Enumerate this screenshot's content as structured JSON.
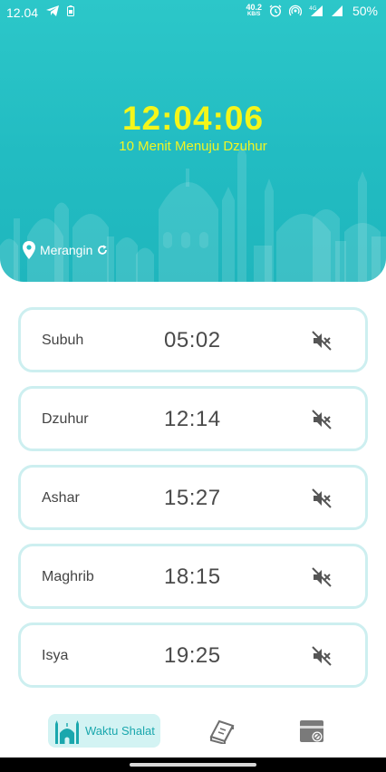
{
  "status_bar": {
    "time": "12.04",
    "speed_value": "40.2",
    "speed_unit": "KB/S",
    "network": "4G",
    "battery": "50%"
  },
  "header": {
    "clock": "12:04:06",
    "countdown": "10 Menit Menuju Dzuhur",
    "location": "Merangin",
    "text_color": "#f4f61a",
    "bg_color": "#25bec4"
  },
  "prayers": [
    {
      "name": "Subuh",
      "time": "05:02",
      "icon": "volume-off-icon"
    },
    {
      "name": "Dzuhur",
      "time": "12:14",
      "icon": "volume-off-icon"
    },
    {
      "name": "Ashar",
      "time": "15:27",
      "icon": "volume-off-icon"
    },
    {
      "name": "Maghrib",
      "time": "18:15",
      "icon": "volume-off-icon"
    },
    {
      "name": "Isya",
      "time": "19:25",
      "icon": "volume-off-icon"
    }
  ],
  "bottom_nav": {
    "active_label": "Waktu Shalat",
    "items": [
      "mosque-icon",
      "quran-book-icon",
      "kaaba-icon"
    ]
  }
}
